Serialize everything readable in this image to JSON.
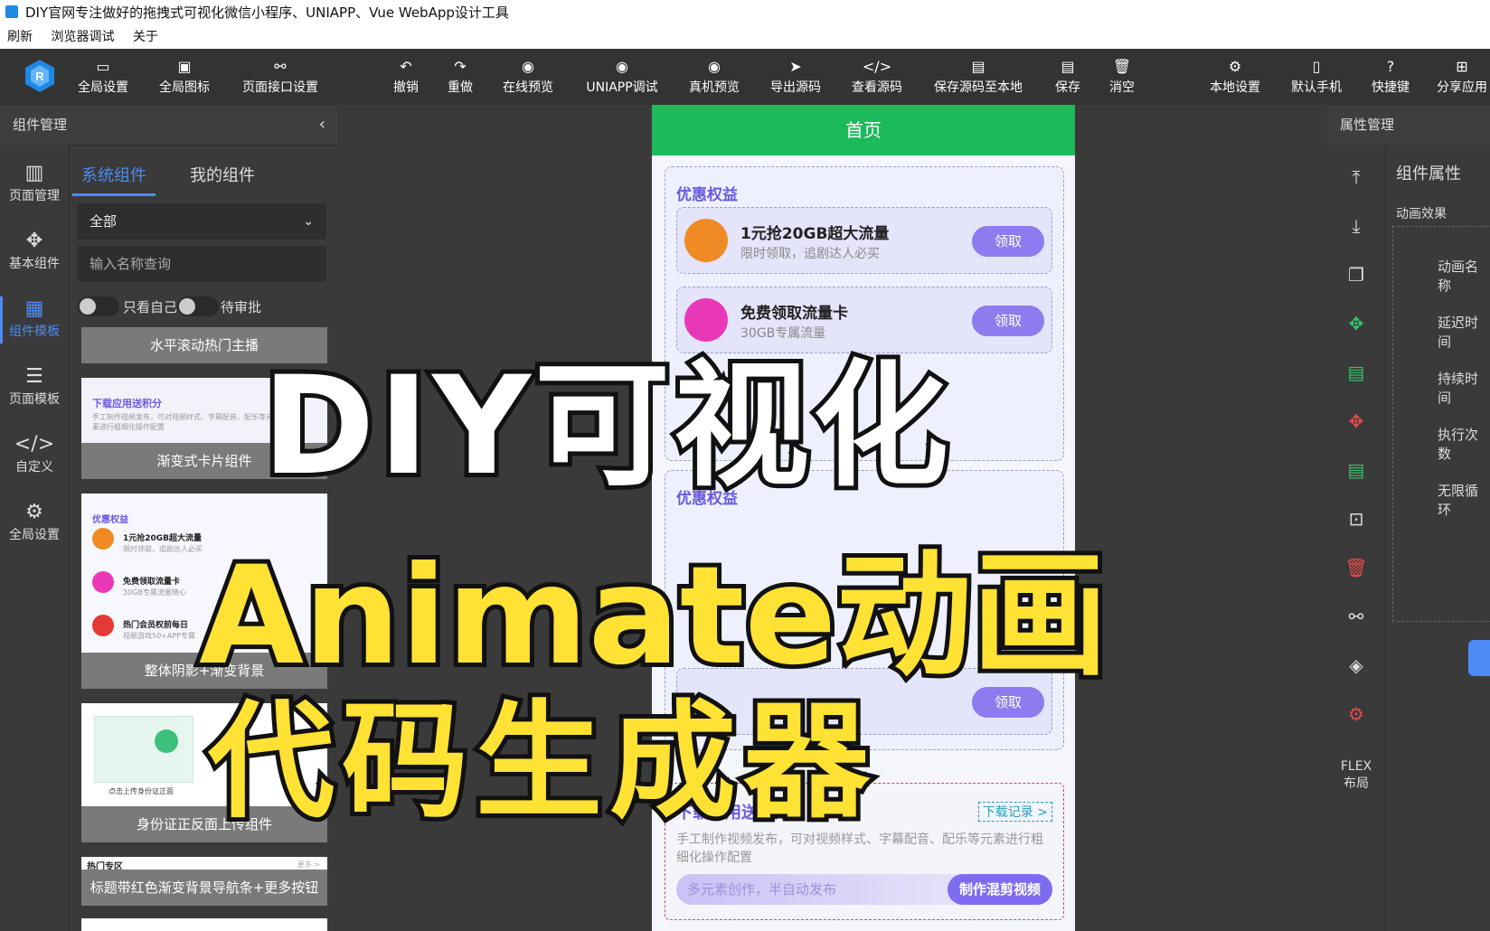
{
  "window": {
    "title": "DIY官网专注做好的拖拽式可视化微信小程序、UNIAPP、Vue WebApp设计工具"
  },
  "menu": [
    "刷新",
    "浏览器调试",
    "关于"
  ],
  "toolbar": {
    "left": [
      {
        "icon": "settings-code-icon",
        "label": "全局设置"
      },
      {
        "icon": "ad-icon",
        "label": "全局图标"
      },
      {
        "icon": "link-icon",
        "label": "页面接口设置"
      }
    ],
    "center": [
      {
        "icon": "undo-icon",
        "label": "撤销"
      },
      {
        "icon": "redo-icon",
        "label": "重做"
      },
      {
        "icon": "eye-icon",
        "label": "在线预览"
      },
      {
        "icon": "eye-icon",
        "label": "UNIAPP调试"
      },
      {
        "icon": "eye-icon",
        "label": "真机预览"
      },
      {
        "icon": "send-icon",
        "label": "导出源码"
      },
      {
        "icon": "code-icon",
        "label": "查看源码"
      },
      {
        "icon": "save-icon",
        "label": "保存源码至本地"
      },
      {
        "icon": "save-icon",
        "label": "保存"
      },
      {
        "icon": "trash-icon",
        "label": "消空"
      }
    ],
    "right": [
      {
        "icon": "gear-icon",
        "label": "本地设置"
      },
      {
        "icon": "phone-icon",
        "label": "默认手机"
      },
      {
        "icon": "help-icon",
        "label": "快捷键"
      },
      {
        "icon": "share-icon",
        "label": "分享应用"
      }
    ]
  },
  "left_panel": {
    "title": "组件管理",
    "nav": [
      {
        "icon": "layout-icon",
        "label": "页面管理"
      },
      {
        "icon": "puzzle-icon",
        "label": "基本组件"
      },
      {
        "icon": "template-icon",
        "label": "组件模板"
      },
      {
        "icon": "database-icon",
        "label": "页面模板"
      },
      {
        "icon": "code-icon",
        "label": "自定义"
      },
      {
        "icon": "gear-icon",
        "label": "全局设置"
      }
    ],
    "tabs": [
      "系统组件",
      "我的组件"
    ],
    "select_value": "全部",
    "search_placeholder": "输入名称查询",
    "toggles": [
      "只看自己",
      "待审批"
    ],
    "cards": [
      {
        "caption": "水平滚动热门主播"
      },
      {
        "caption": "渐变式卡片组件",
        "preview_title": "下载应用送积分",
        "preview_text": "手工制作视频发布，可对视频样式、字幕配音、配乐等元素进行粗细化操作配置",
        "preview_tag": "多元素创作，半自动发布"
      },
      {
        "caption": "整体阴影+渐变背景",
        "preview_title": "优惠权益",
        "preview_items": [
          "1元抢20GB超大流量",
          "免费领取流量卡",
          "热门会员权前每日"
        ],
        "preview_desc": [
          "限时领取，追剧达人必买",
          "30GB专属流量随心",
          "视频游戏50+APP专属"
        ]
      },
      {
        "caption": "身份证正反面上传组件",
        "preview_text": "点击上传身份证正面"
      },
      {
        "caption": "标题带红色渐变背景导航条+更多按钮",
        "preview_title": "热门专区",
        "preview_more": "更多 >"
      }
    ]
  },
  "phone": {
    "header": "首页",
    "section_title": "优惠权益",
    "items": [
      {
        "name": "1元抢20GB超大流量",
        "desc": "限时领取，追剧达人必买",
        "btn": "领取"
      },
      {
        "name": "免费领取流量卡",
        "desc": "30GB专属流量",
        "btn": "领取"
      }
    ],
    "section2_title": "优惠权益",
    "item3_btn": "领取",
    "download": {
      "title": "下载应用送积分",
      "record": "下载记录 >",
      "text": "手工制作视频发布，可对视频样式、字幕配音、配乐等元素进行粗细化操作配置",
      "tag": "多元素创作，半自动发布",
      "btn": "制作混剪视频"
    }
  },
  "right_panel": {
    "title": "属性管理",
    "tab": "组件属性",
    "section": "动画效果",
    "props": [
      "动画名称",
      "延迟时间",
      "持续时间",
      "执行次数",
      "无限循环"
    ],
    "flex_label": "FLEX\n布局"
  },
  "overlay": {
    "line1": "DIY可视化",
    "line2": "Animate动画",
    "line3": "代码生成器"
  },
  "colors": {
    "accent": "#4c8bf5",
    "header_green": "#1dba5c",
    "purple": "#8c7cf0",
    "overlay_yellow": "#ffe234"
  }
}
